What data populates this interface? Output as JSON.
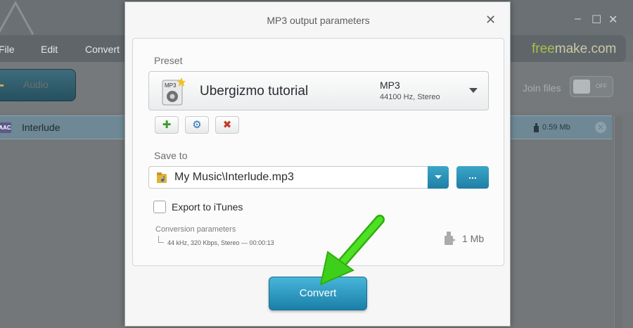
{
  "app": {
    "window_controls": [
      "–",
      "☐",
      "✕"
    ],
    "menu": [
      "File",
      "Edit",
      "Convert"
    ],
    "brand": {
      "prefix": "free",
      "suffix": "make.com"
    },
    "toolbar": {
      "audio_button": "Audio",
      "join_label": "Join files",
      "toggle_state": "OFF"
    },
    "file_list": [
      {
        "badge": "AAC",
        "name": "Interlude",
        "size": "0.59 Mb"
      }
    ]
  },
  "dialog": {
    "title": "MP3 output parameters",
    "close": "✕",
    "preset": {
      "label": "Preset",
      "name": "Ubergizmo tutorial",
      "format": "MP3",
      "info": "44100 Hz,  Stereo",
      "icon_text": "MP3"
    },
    "preset_actions": [
      {
        "name": "add-preset-button",
        "glyph": "✚",
        "color": "#3a9a2a"
      },
      {
        "name": "edit-preset-button",
        "glyph": "⚙",
        "color": "#2a72b8"
      },
      {
        "name": "delete-preset-button",
        "glyph": "✖",
        "color": "#c23a2a"
      }
    ],
    "save_to": {
      "label": "Save to",
      "path": "My Music\\Interlude.mp3",
      "browse": "..."
    },
    "export_itunes": {
      "label": "Export to iTunes",
      "checked": false
    },
    "conversion": {
      "label": "Conversion parameters",
      "detail": "44 kHz, 320 Kbps, Stereo — 00:00:13",
      "size": "1 Mb"
    },
    "convert_button": "Convert"
  },
  "colors": {
    "accent": "#1f7ea5",
    "arrow": "#3ecf1a"
  }
}
